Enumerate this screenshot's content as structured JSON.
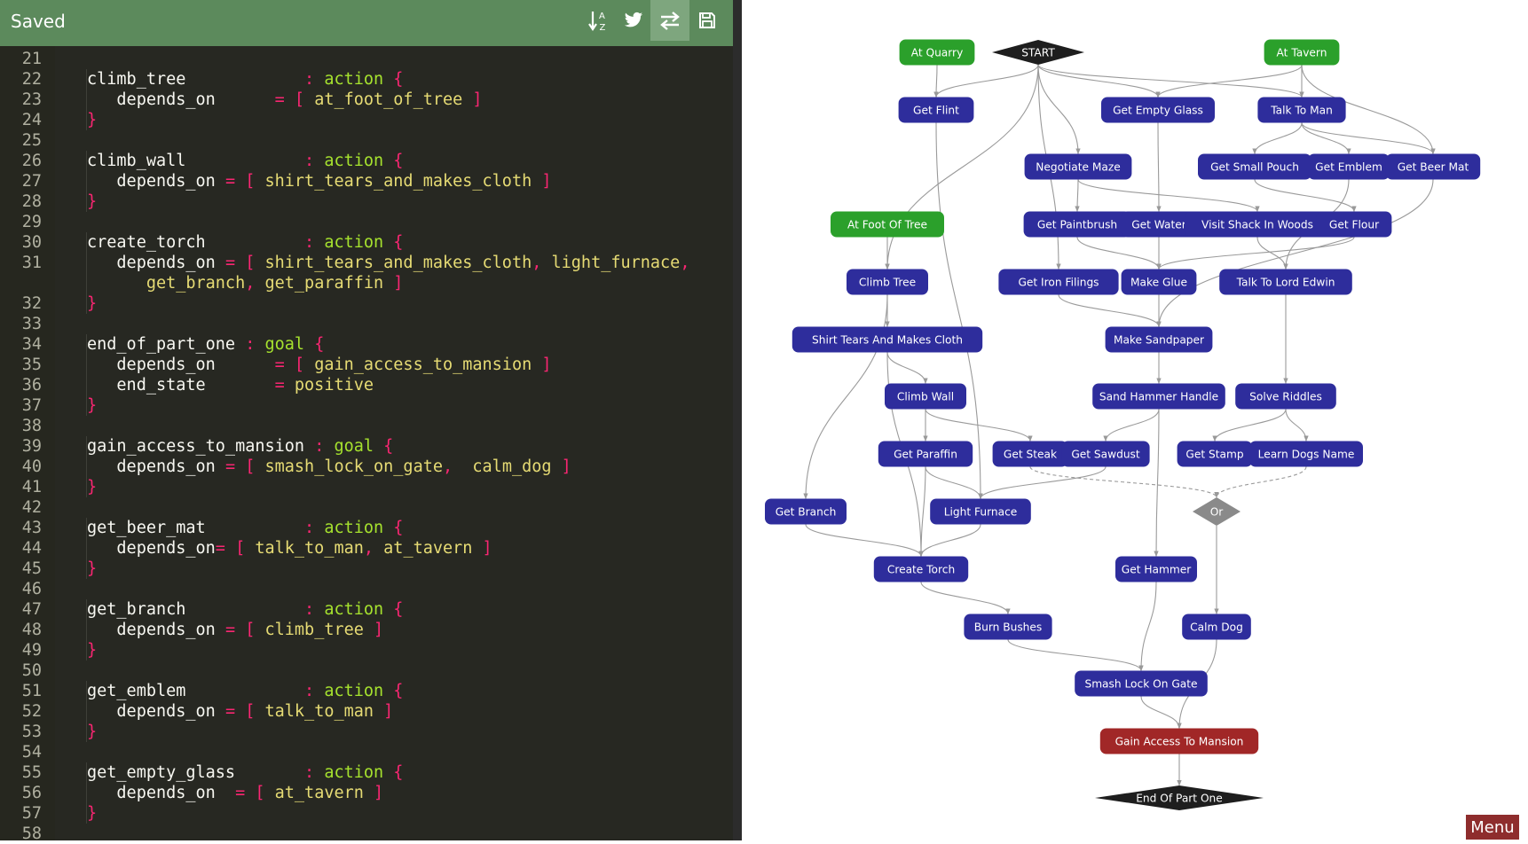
{
  "toolbar": {
    "status": "Saved",
    "buttons": [
      {
        "icon": "sort-az-icon"
      },
      {
        "icon": "twitter-icon"
      },
      {
        "icon": "swap-arrows-icon"
      },
      {
        "icon": "save-icon"
      }
    ]
  },
  "colors": {
    "toolbar_bg": "#5c8a5c",
    "editor_bg": "#272822",
    "identifier": "#f8f8f2",
    "keyword": "#f92672",
    "type": "#a6e22e",
    "value": "#e6db74",
    "node_action": "#2e2d9c",
    "node_start": "#2ba02b",
    "node_goal": "#a12727",
    "node_black": "#1e1e1e",
    "node_or": "#8a8a8a",
    "menu": "#8e2d2d"
  },
  "editor": {
    "lines": [
      {
        "n": "21",
        "tokens": []
      },
      {
        "n": "22",
        "tokens": [
          {
            "t": "climb_tree            ",
            "c": "id"
          },
          {
            "t": ": ",
            "c": "kw"
          },
          {
            "t": "action",
            "c": "ty"
          },
          {
            "t": " {",
            "c": "kw"
          }
        ]
      },
      {
        "n": "23",
        "tokens": [
          {
            "t": "   depends_on      ",
            "c": "id"
          },
          {
            "t": "= [ ",
            "c": "kw"
          },
          {
            "t": "at_foot_of_tree",
            "c": "val"
          },
          {
            "t": " ]",
            "c": "kw"
          }
        ]
      },
      {
        "n": "24",
        "tokens": [
          {
            "t": "}",
            "c": "kw"
          }
        ]
      },
      {
        "n": "25",
        "tokens": []
      },
      {
        "n": "26",
        "tokens": [
          {
            "t": "climb_wall            ",
            "c": "id"
          },
          {
            "t": ": ",
            "c": "kw"
          },
          {
            "t": "action",
            "c": "ty"
          },
          {
            "t": " {",
            "c": "kw"
          }
        ]
      },
      {
        "n": "27",
        "tokens": [
          {
            "t": "   depends_on ",
            "c": "id"
          },
          {
            "t": "= [ ",
            "c": "kw"
          },
          {
            "t": "shirt_tears_and_makes_cloth",
            "c": "val"
          },
          {
            "t": " ]",
            "c": "kw"
          }
        ]
      },
      {
        "n": "28",
        "tokens": [
          {
            "t": "}",
            "c": "kw"
          }
        ]
      },
      {
        "n": "29",
        "tokens": []
      },
      {
        "n": "30",
        "tokens": [
          {
            "t": "create_torch          ",
            "c": "id"
          },
          {
            "t": ": ",
            "c": "kw"
          },
          {
            "t": "action",
            "c": "ty"
          },
          {
            "t": " {",
            "c": "kw"
          }
        ]
      },
      {
        "n": "31",
        "tokens": [
          {
            "t": "   depends_on ",
            "c": "id"
          },
          {
            "t": "= [ ",
            "c": "kw"
          },
          {
            "t": "shirt_tears_and_makes_cloth",
            "c": "val"
          },
          {
            "t": ", ",
            "c": "kw"
          },
          {
            "t": "light_furnace",
            "c": "val"
          },
          {
            "t": ",",
            "c": "kw"
          }
        ]
      },
      {
        "n": "",
        "tokens": [
          {
            "t": "      ",
            "c": "id"
          },
          {
            "t": "get_branch",
            "c": "val"
          },
          {
            "t": ", ",
            "c": "kw"
          },
          {
            "t": "get_paraffin",
            "c": "val"
          },
          {
            "t": " ]",
            "c": "kw"
          }
        ]
      },
      {
        "n": "32",
        "tokens": [
          {
            "t": "}",
            "c": "kw"
          }
        ]
      },
      {
        "n": "33",
        "tokens": []
      },
      {
        "n": "34",
        "tokens": [
          {
            "t": "end_of_part_one ",
            "c": "id"
          },
          {
            "t": ": ",
            "c": "kw"
          },
          {
            "t": "goal",
            "c": "ty"
          },
          {
            "t": " {",
            "c": "kw"
          }
        ]
      },
      {
        "n": "35",
        "tokens": [
          {
            "t": "   depends_on      ",
            "c": "id"
          },
          {
            "t": "= [ ",
            "c": "kw"
          },
          {
            "t": "gain_access_to_mansion",
            "c": "val"
          },
          {
            "t": " ]",
            "c": "kw"
          }
        ]
      },
      {
        "n": "36",
        "tokens": [
          {
            "t": "   end_state       ",
            "c": "id"
          },
          {
            "t": "= ",
            "c": "kw"
          },
          {
            "t": "positive",
            "c": "val"
          }
        ]
      },
      {
        "n": "37",
        "tokens": [
          {
            "t": "}",
            "c": "kw"
          }
        ]
      },
      {
        "n": "38",
        "tokens": []
      },
      {
        "n": "39",
        "tokens": [
          {
            "t": "gain_access_to_mansion ",
            "c": "id"
          },
          {
            "t": ": ",
            "c": "kw"
          },
          {
            "t": "goal",
            "c": "ty"
          },
          {
            "t": " {",
            "c": "kw"
          }
        ]
      },
      {
        "n": "40",
        "tokens": [
          {
            "t": "   depends_on ",
            "c": "id"
          },
          {
            "t": "= [ ",
            "c": "kw"
          },
          {
            "t": "smash_lock_on_gate",
            "c": "val"
          },
          {
            "t": ",  ",
            "c": "kw"
          },
          {
            "t": "calm_dog",
            "c": "val"
          },
          {
            "t": " ]",
            "c": "kw"
          }
        ]
      },
      {
        "n": "41",
        "tokens": [
          {
            "t": "}",
            "c": "kw"
          }
        ]
      },
      {
        "n": "42",
        "tokens": []
      },
      {
        "n": "43",
        "tokens": [
          {
            "t": "get_beer_mat          ",
            "c": "id"
          },
          {
            "t": ": ",
            "c": "kw"
          },
          {
            "t": "action",
            "c": "ty"
          },
          {
            "t": " {",
            "c": "kw"
          }
        ]
      },
      {
        "n": "44",
        "tokens": [
          {
            "t": "   depends_on",
            "c": "id"
          },
          {
            "t": "= [ ",
            "c": "kw"
          },
          {
            "t": "talk_to_man",
            "c": "val"
          },
          {
            "t": ", ",
            "c": "kw"
          },
          {
            "t": "at_tavern",
            "c": "val"
          },
          {
            "t": " ]",
            "c": "kw"
          }
        ]
      },
      {
        "n": "45",
        "tokens": [
          {
            "t": "}",
            "c": "kw"
          }
        ]
      },
      {
        "n": "46",
        "tokens": []
      },
      {
        "n": "47",
        "tokens": [
          {
            "t": "get_branch            ",
            "c": "id"
          },
          {
            "t": ": ",
            "c": "kw"
          },
          {
            "t": "action",
            "c": "ty"
          },
          {
            "t": " {",
            "c": "kw"
          }
        ]
      },
      {
        "n": "48",
        "tokens": [
          {
            "t": "   depends_on ",
            "c": "id"
          },
          {
            "t": "= [ ",
            "c": "kw"
          },
          {
            "t": "climb_tree",
            "c": "val"
          },
          {
            "t": " ]",
            "c": "kw"
          }
        ]
      },
      {
        "n": "49",
        "tokens": [
          {
            "t": "}",
            "c": "kw"
          }
        ]
      },
      {
        "n": "50",
        "tokens": []
      },
      {
        "n": "51",
        "tokens": [
          {
            "t": "get_emblem            ",
            "c": "id"
          },
          {
            "t": ": ",
            "c": "kw"
          },
          {
            "t": "action",
            "c": "ty"
          },
          {
            "t": " {",
            "c": "kw"
          }
        ]
      },
      {
        "n": "52",
        "tokens": [
          {
            "t": "   depends_on ",
            "c": "id"
          },
          {
            "t": "= [ ",
            "c": "kw"
          },
          {
            "t": "talk_to_man",
            "c": "val"
          },
          {
            "t": " ]",
            "c": "kw"
          }
        ]
      },
      {
        "n": "53",
        "tokens": [
          {
            "t": "}",
            "c": "kw"
          }
        ]
      },
      {
        "n": "54",
        "tokens": []
      },
      {
        "n": "55",
        "tokens": [
          {
            "t": "get_empty_glass       ",
            "c": "id"
          },
          {
            "t": ": ",
            "c": "kw"
          },
          {
            "t": "action",
            "c": "ty"
          },
          {
            "t": " {",
            "c": "kw"
          }
        ]
      },
      {
        "n": "56",
        "tokens": [
          {
            "t": "   depends_on  ",
            "c": "id"
          },
          {
            "t": "= [ ",
            "c": "kw"
          },
          {
            "t": "at_tavern",
            "c": "val"
          },
          {
            "t": " ]",
            "c": "kw"
          }
        ]
      },
      {
        "n": "57",
        "tokens": [
          {
            "t": "}",
            "c": "kw"
          }
        ]
      },
      {
        "n": "58",
        "tokens": []
      }
    ]
  },
  "graph": {
    "nodes": [
      {
        "id": "start",
        "label": "START",
        "kind": "black"
      },
      {
        "id": "at_quarry",
        "label": "At Quarry",
        "kind": "start"
      },
      {
        "id": "at_tavern",
        "label": "At Tavern",
        "kind": "start"
      },
      {
        "id": "get_flint",
        "label": "Get Flint",
        "kind": "action"
      },
      {
        "id": "get_empty_glass",
        "label": "Get Empty Glass",
        "kind": "action"
      },
      {
        "id": "talk_to_man",
        "label": "Talk To Man",
        "kind": "action"
      },
      {
        "id": "negotiate_maze",
        "label": "Negotiate Maze",
        "kind": "action"
      },
      {
        "id": "get_small_pouch",
        "label": "Get Small Pouch",
        "kind": "action"
      },
      {
        "id": "get_emblem",
        "label": "Get Emblem",
        "kind": "action"
      },
      {
        "id": "get_beer_mat",
        "label": "Get Beer Mat",
        "kind": "action"
      },
      {
        "id": "at_foot_of_tree",
        "label": "At Foot Of Tree",
        "kind": "start"
      },
      {
        "id": "get_paintbrush",
        "label": "Get Paintbrush",
        "kind": "action"
      },
      {
        "id": "get_water",
        "label": "Get Water",
        "kind": "action"
      },
      {
        "id": "visit_shack",
        "label": "Visit Shack In Woods",
        "kind": "action"
      },
      {
        "id": "get_flour",
        "label": "Get Flour",
        "kind": "action"
      },
      {
        "id": "climb_tree",
        "label": "Climb Tree",
        "kind": "action"
      },
      {
        "id": "get_iron_filings",
        "label": "Get Iron Filings",
        "kind": "action"
      },
      {
        "id": "make_glue",
        "label": "Make Glue",
        "kind": "action"
      },
      {
        "id": "talk_lord_edwin",
        "label": "Talk To Lord Edwin",
        "kind": "action"
      },
      {
        "id": "shirt_tears",
        "label": "Shirt Tears And Makes Cloth",
        "kind": "action"
      },
      {
        "id": "make_sandpaper",
        "label": "Make Sandpaper",
        "kind": "action"
      },
      {
        "id": "climb_wall",
        "label": "Climb Wall",
        "kind": "action"
      },
      {
        "id": "sand_hammer",
        "label": "Sand Hammer Handle",
        "kind": "action"
      },
      {
        "id": "solve_riddles",
        "label": "Solve Riddles",
        "kind": "action"
      },
      {
        "id": "get_paraffin",
        "label": "Get Paraffin",
        "kind": "action"
      },
      {
        "id": "get_steak",
        "label": "Get Steak",
        "kind": "action"
      },
      {
        "id": "get_sawdust",
        "label": "Get Sawdust",
        "kind": "action"
      },
      {
        "id": "get_stamp",
        "label": "Get Stamp",
        "kind": "action"
      },
      {
        "id": "learn_dogs_name",
        "label": "Learn Dogs Name",
        "kind": "action"
      },
      {
        "id": "get_branch",
        "label": "Get Branch",
        "kind": "action"
      },
      {
        "id": "light_furnace",
        "label": "Light Furnace",
        "kind": "action"
      },
      {
        "id": "or",
        "label": "Or",
        "kind": "or"
      },
      {
        "id": "create_torch",
        "label": "Create Torch",
        "kind": "action"
      },
      {
        "id": "get_hammer",
        "label": "Get Hammer",
        "kind": "action"
      },
      {
        "id": "burn_bushes",
        "label": "Burn Bushes",
        "kind": "action"
      },
      {
        "id": "calm_dog",
        "label": "Calm Dog",
        "kind": "action"
      },
      {
        "id": "smash_lock",
        "label": "Smash Lock On Gate",
        "kind": "action"
      },
      {
        "id": "gain_access",
        "label": "Gain Access To Mansion",
        "kind": "goal"
      },
      {
        "id": "end_part_one",
        "label": "End Of Part One",
        "kind": "black"
      }
    ],
    "edges": [
      [
        "start",
        "get_flint"
      ],
      [
        "start",
        "get_empty_glass"
      ],
      [
        "start",
        "talk_to_man"
      ],
      [
        "start",
        "negotiate_maze"
      ],
      [
        "start",
        "climb_tree"
      ],
      [
        "start",
        "get_iron_filings"
      ],
      [
        "at_quarry",
        "get_flint"
      ],
      [
        "at_tavern",
        "get_empty_glass"
      ],
      [
        "at_tavern",
        "talk_to_man"
      ],
      [
        "at_tavern",
        "get_beer_mat"
      ],
      [
        "talk_to_man",
        "get_small_pouch"
      ],
      [
        "talk_to_man",
        "get_emblem"
      ],
      [
        "talk_to_man",
        "get_beer_mat"
      ],
      [
        "negotiate_maze",
        "get_paintbrush"
      ],
      [
        "negotiate_maze",
        "visit_shack"
      ],
      [
        "get_empty_glass",
        "get_water"
      ],
      [
        "get_small_pouch",
        "get_flour"
      ],
      [
        "get_paintbrush",
        "make_glue"
      ],
      [
        "get_water",
        "make_glue"
      ],
      [
        "get_flour",
        "make_glue"
      ],
      [
        "visit_shack",
        "talk_lord_edwin"
      ],
      [
        "get_emblem",
        "talk_lord_edwin"
      ],
      [
        "at_foot_of_tree",
        "climb_tree"
      ],
      [
        "climb_tree",
        "shirt_tears"
      ],
      [
        "climb_tree",
        "get_branch"
      ],
      [
        "get_iron_filings",
        "make_sandpaper"
      ],
      [
        "make_glue",
        "make_sandpaper"
      ],
      [
        "get_beer_mat",
        "make_sandpaper"
      ],
      [
        "shirt_tears",
        "climb_wall"
      ],
      [
        "shirt_tears",
        "create_torch"
      ],
      [
        "make_sandpaper",
        "sand_hammer"
      ],
      [
        "talk_lord_edwin",
        "solve_riddles"
      ],
      [
        "climb_wall",
        "get_paraffin"
      ],
      [
        "climb_wall",
        "get_steak"
      ],
      [
        "sand_hammer",
        "get_sawdust"
      ],
      [
        "sand_hammer",
        "get_hammer"
      ],
      [
        "solve_riddles",
        "get_stamp"
      ],
      [
        "solve_riddles",
        "learn_dogs_name"
      ],
      [
        "get_flint",
        "light_furnace"
      ],
      [
        "get_paraffin",
        "light_furnace"
      ],
      [
        "get_sawdust",
        "light_furnace"
      ],
      [
        "get_paraffin",
        "create_torch"
      ],
      [
        "get_branch",
        "create_torch"
      ],
      [
        "light_furnace",
        "create_torch"
      ],
      [
        "create_torch",
        "burn_bushes"
      ],
      [
        "burn_bushes",
        "smash_lock"
      ],
      [
        "get_hammer",
        "smash_lock"
      ],
      [
        "or",
        "calm_dog"
      ],
      [
        "smash_lock",
        "gain_access"
      ],
      [
        "calm_dog",
        "gain_access"
      ],
      [
        "gain_access",
        "end_part_one"
      ]
    ],
    "dashed_edges": [
      [
        "get_steak",
        "or"
      ],
      [
        "learn_dogs_name",
        "or"
      ]
    ]
  },
  "menu": {
    "label": "Menu"
  }
}
